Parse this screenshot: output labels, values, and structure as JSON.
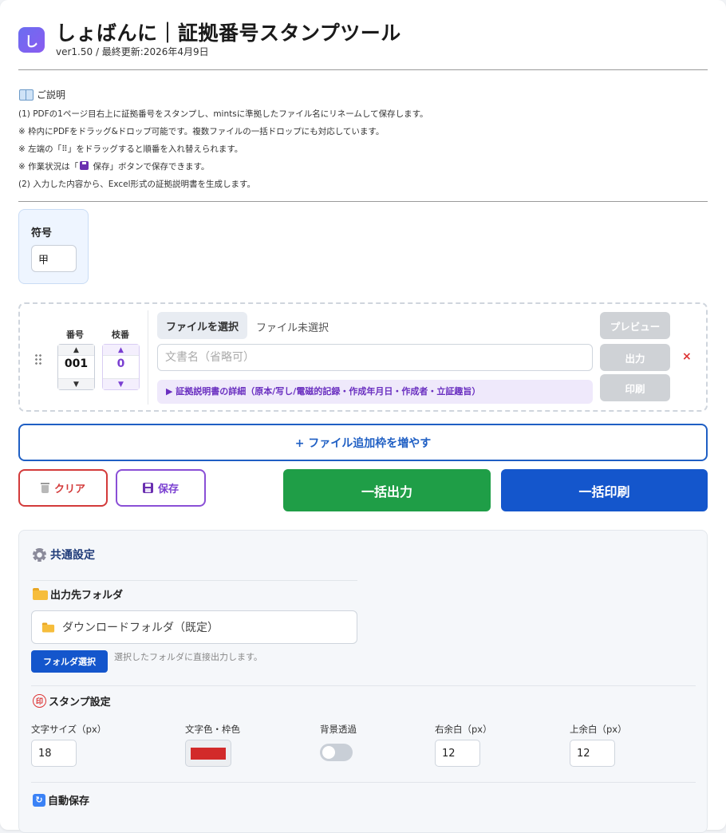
{
  "header": {
    "logo_char": "し",
    "title": "しょばんに｜証拠番号スタンプツール",
    "version": "ver1.50 / 最終更新:2026年4月9日"
  },
  "description": {
    "title": "ご説明",
    "lines": [
      "(1) PDFの1ページ目右上に証拠番号をスタンプし、mintsに準拠したファイル名にリネームして保存します。",
      "※ 枠内にPDFをドラッグ&ドロップ可能です。複数ファイルの一括ドロップにも対応しています。",
      "※ 左端の「⠿」をドラッグすると順番を入れ替えられます。",
      "※ 作業状況は「",
      "保存」ボタンで保存できます。",
      "(2) 入力した内容から、Excel形式の証拠説明書を生成します。"
    ]
  },
  "symbol": {
    "label": "符号",
    "value": "甲"
  },
  "file_row": {
    "number_label": "番号",
    "branch_label": "枝番",
    "number_value": "001",
    "branch_value": "0",
    "up_arrow": "▲",
    "down_arrow": "▼",
    "choose_file": "ファイルを選択",
    "no_file": "ファイル未選択",
    "docname_placeholder": "文書名（省略可）",
    "details": "▶ 証拠説明書の詳細（原本/写し/電磁的記録・作成年月日・作成者・立証趣旨）",
    "preview": "プレビュー",
    "output": "出力",
    "print": "印刷",
    "remove": "×"
  },
  "actions": {
    "add_frame": "+ ファイル追加枠を増やす",
    "clear": "クリア",
    "save": "保存",
    "bulk_output": "一括出力",
    "bulk_print": "一括印刷"
  },
  "settings": {
    "title": "共通設定",
    "output_folder_title": "出力先フォルダ",
    "folder_value": "ダウンロードフォルダ（既定）",
    "folder_button": "フォルダ選択",
    "folder_note": "選択したフォルダに直接出力します。",
    "stamp_title": "スタンプ設定",
    "stamp_glyph": "印",
    "font_size_label": "文字サイズ（px）",
    "font_size_value": "18",
    "color_label": "文字色・枠色",
    "color_value": "#d22a2a",
    "transparent_label": "背景透過",
    "transparent_on": false,
    "right_margin_label": "右余白（px）",
    "right_margin_value": "12",
    "top_margin_label": "上余白（px）",
    "top_margin_value": "12",
    "autosave_title": "自動保存"
  }
}
